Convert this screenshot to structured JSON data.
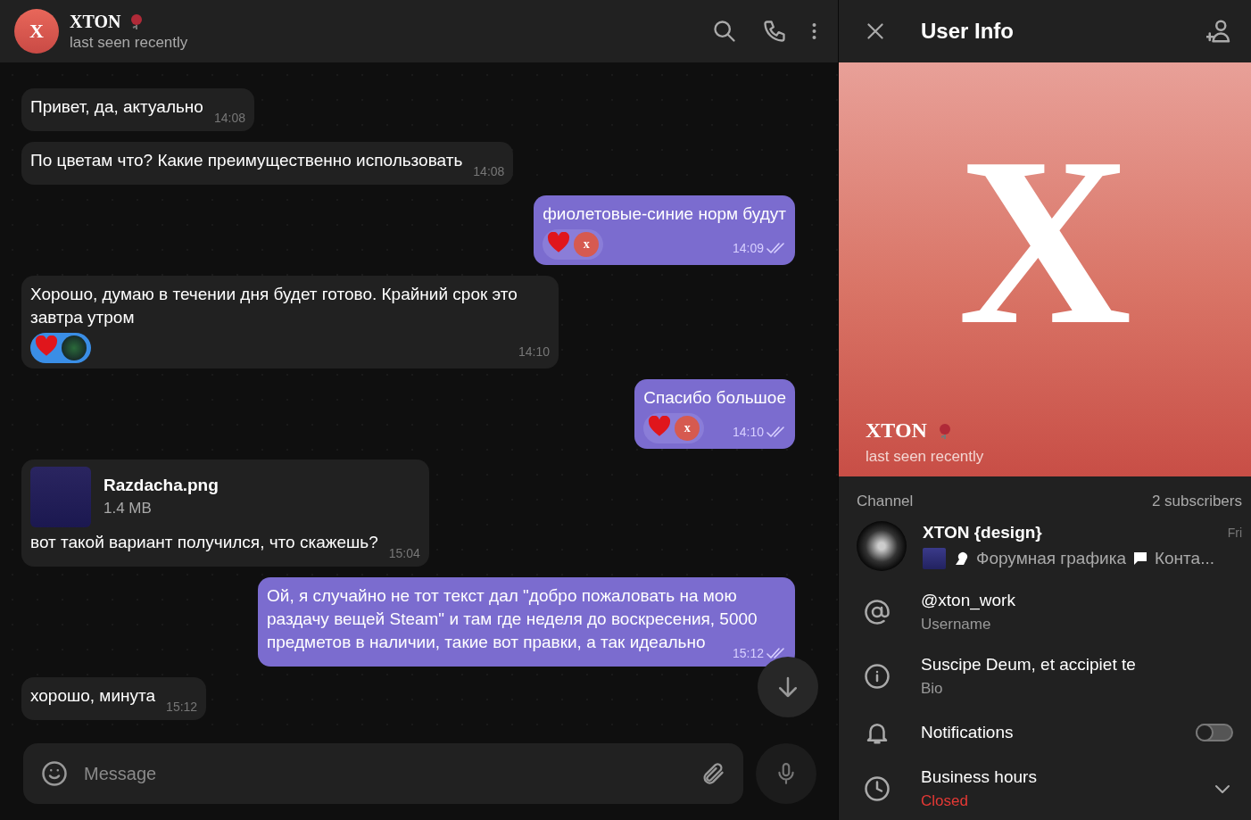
{
  "chat_header": {
    "avatar_letter": "X",
    "name": "XTON",
    "status": "last seen recently"
  },
  "messages": [
    {
      "kind": "text",
      "outgoing": false,
      "text": "Привет, да, актуально",
      "time": "14:08"
    },
    {
      "kind": "text",
      "outgoing": false,
      "text": "По цветам что? Какие преимущественно использовать",
      "time": "14:08"
    },
    {
      "kind": "text",
      "outgoing": true,
      "text": "фиолетовые-синие норм будут",
      "time": "14:09",
      "read": true,
      "reactions": {
        "selected": false,
        "items": [
          {
            "kind": "heart"
          },
          {
            "kind": "avatar",
            "letter": "x"
          }
        ]
      }
    },
    {
      "kind": "text",
      "outgoing": false,
      "text": "Хорошо, думаю в течении дня будет готово. Крайний срок это завтра утром",
      "time": "14:10",
      "reactions": {
        "selected": true,
        "items": [
          {
            "kind": "heart"
          },
          {
            "kind": "picture"
          }
        ]
      }
    },
    {
      "kind": "text",
      "outgoing": true,
      "text": "Спасибо большое",
      "time": "14:10",
      "read": true,
      "reactions": {
        "selected": false,
        "items": [
          {
            "kind": "heart"
          },
          {
            "kind": "avatar",
            "letter": "x"
          }
        ]
      }
    },
    {
      "kind": "file",
      "outgoing": false,
      "file_name": "Razdacha.png",
      "file_size": "1.4 MB",
      "text": "вот такой вариант получился, что скажешь?",
      "time": "15:04"
    },
    {
      "kind": "text",
      "outgoing": true,
      "text": "Ой, я случайно не тот текст дал \"добро пожаловать на мою раздачу вещей Steam\" и там где неделя до воскресения, 5000 предметов в наличии, такие вот правки, а так идеально",
      "time": "15:12",
      "read": true
    },
    {
      "kind": "text",
      "outgoing": false,
      "text": "хорошо, минута",
      "time": "15:12"
    }
  ],
  "composer": {
    "placeholder": "Message"
  },
  "user_info": {
    "title": "User Info",
    "avatar_letter": "X",
    "name": "XTON",
    "status": "last seen recently",
    "channel": {
      "label": "Channel",
      "subscribers": "2 subscribers",
      "name": "XTON {design}",
      "date": "Fri",
      "preview": "Форумная графика",
      "preview_2": "Конта..."
    },
    "rows": [
      {
        "kind": "username",
        "value": "@xton_work",
        "caption": "Username"
      },
      {
        "kind": "bio",
        "value": "Suscipe Deum, et accipiet te",
        "caption": "Bio"
      },
      {
        "kind": "notifications",
        "value": "Notifications",
        "on": false
      },
      {
        "kind": "hours",
        "value": "Business hours",
        "caption": "Closed",
        "expanded": false
      }
    ]
  }
}
